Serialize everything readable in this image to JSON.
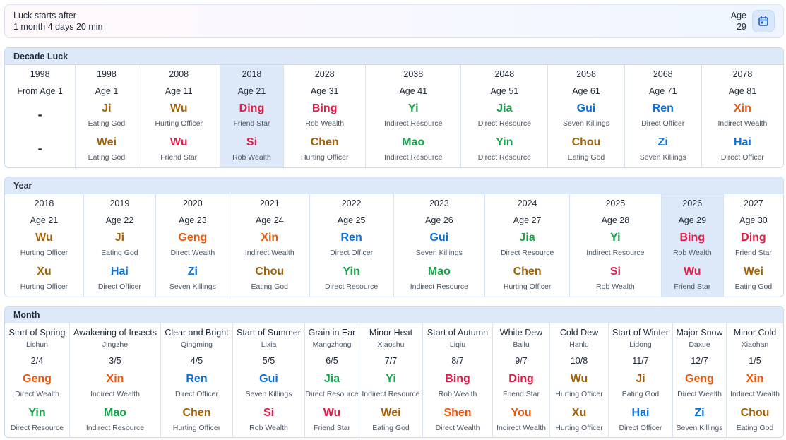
{
  "header": {
    "luck_label": "Luck starts after",
    "luck_value": "1 month 4 days 20 min",
    "age_label": "Age",
    "age_value": "29",
    "calendar_icon": "calendar-icon"
  },
  "colors": {
    "wood": "#16a34a",
    "fire": "#e11d48",
    "earth": "#a16207",
    "metal": "#ea580c",
    "water": "#0b6fd6",
    "highlight": "#dde9f8"
  },
  "decade": {
    "title": "Decade Luck",
    "columns": [
      {
        "year": "1998",
        "age": "From Age 1",
        "stem": "-",
        "stem_god": "",
        "branch": "-",
        "branch_god": "",
        "el_s": "none",
        "el_b": "none"
      },
      {
        "year": "1998",
        "age": "Age 1",
        "stem": "Ji",
        "stem_god": "Eating God",
        "branch": "Wei",
        "branch_god": "Eating God",
        "el_s": "earth",
        "el_b": "earth"
      },
      {
        "year": "2008",
        "age": "Age 11",
        "stem": "Wu",
        "stem_god": "Hurting Officer",
        "branch": "Wu",
        "branch_god": "Friend Star",
        "el_s": "earth",
        "el_b": "fire"
      },
      {
        "year": "2018",
        "age": "Age 21",
        "stem": "Ding",
        "stem_god": "Friend Star",
        "branch": "Si",
        "branch_god": "Rob Wealth",
        "el_s": "fire",
        "el_b": "fire",
        "highlight": true
      },
      {
        "year": "2028",
        "age": "Age 31",
        "stem": "Bing",
        "stem_god": "Rob Wealth",
        "branch": "Chen",
        "branch_god": "Hurting Officer",
        "el_s": "fire",
        "el_b": "earth"
      },
      {
        "year": "2038",
        "age": "Age 41",
        "stem": "Yi",
        "stem_god": "Indirect Resource",
        "branch": "Mao",
        "branch_god": "Indirect Resource",
        "el_s": "wood",
        "el_b": "wood"
      },
      {
        "year": "2048",
        "age": "Age 51",
        "stem": "Jia",
        "stem_god": "Direct Resource",
        "branch": "Yin",
        "branch_god": "Direct Resource",
        "el_s": "wood",
        "el_b": "wood"
      },
      {
        "year": "2058",
        "age": "Age 61",
        "stem": "Gui",
        "stem_god": "Seven Killings",
        "branch": "Chou",
        "branch_god": "Eating God",
        "el_s": "water",
        "el_b": "earth"
      },
      {
        "year": "2068",
        "age": "Age 71",
        "stem": "Ren",
        "stem_god": "Direct Officer",
        "branch": "Zi",
        "branch_god": "Seven Killings",
        "el_s": "water",
        "el_b": "water"
      },
      {
        "year": "2078",
        "age": "Age 81",
        "stem": "Xin",
        "stem_god": "Indirect Wealth",
        "branch": "Hai",
        "branch_god": "Direct Officer",
        "el_s": "metal",
        "el_b": "water"
      }
    ]
  },
  "year": {
    "title": "Year",
    "columns": [
      {
        "year": "2018",
        "age": "Age 21",
        "stem": "Wu",
        "stem_god": "Hurting Officer",
        "branch": "Xu",
        "branch_god": "Hurting Officer",
        "el_s": "earth",
        "el_b": "earth"
      },
      {
        "year": "2019",
        "age": "Age 22",
        "stem": "Ji",
        "stem_god": "Eating God",
        "branch": "Hai",
        "branch_god": "Direct Officer",
        "el_s": "earth",
        "el_b": "water"
      },
      {
        "year": "2020",
        "age": "Age 23",
        "stem": "Geng",
        "stem_god": "Direct Wealth",
        "branch": "Zi",
        "branch_god": "Seven Killings",
        "el_s": "metal",
        "el_b": "water"
      },
      {
        "year": "2021",
        "age": "Age 24",
        "stem": "Xin",
        "stem_god": "Indirect Wealth",
        "branch": "Chou",
        "branch_god": "Eating God",
        "el_s": "metal",
        "el_b": "earth"
      },
      {
        "year": "2022",
        "age": "Age 25",
        "stem": "Ren",
        "stem_god": "Direct Officer",
        "branch": "Yin",
        "branch_god": "Direct Resource",
        "el_s": "water",
        "el_b": "wood"
      },
      {
        "year": "2023",
        "age": "Age 26",
        "stem": "Gui",
        "stem_god": "Seven Killings",
        "branch": "Mao",
        "branch_god": "Indirect Resource",
        "el_s": "water",
        "el_b": "wood"
      },
      {
        "year": "2024",
        "age": "Age 27",
        "stem": "Jia",
        "stem_god": "Direct Resource",
        "branch": "Chen",
        "branch_god": "Hurting Officer",
        "el_s": "wood",
        "el_b": "earth"
      },
      {
        "year": "2025",
        "age": "Age 28",
        "stem": "Yi",
        "stem_god": "Indirect Resource",
        "branch": "Si",
        "branch_god": "Rob Wealth",
        "el_s": "wood",
        "el_b": "fire"
      },
      {
        "year": "2026",
        "age": "Age 29",
        "stem": "Bing",
        "stem_god": "Rob Wealth",
        "branch": "Wu",
        "branch_god": "Friend Star",
        "el_s": "fire",
        "el_b": "fire",
        "highlight": true
      },
      {
        "year": "2027",
        "age": "Age 30",
        "stem": "Ding",
        "stem_god": "Friend Star",
        "branch": "Wei",
        "branch_god": "Eating God",
        "el_s": "fire",
        "el_b": "earth"
      }
    ]
  },
  "month": {
    "title": "Month",
    "columns": [
      {
        "name": "Start of Spring",
        "pinyin": "Lichun",
        "date": "2/4",
        "stem": "Geng",
        "stem_god": "Direct Wealth",
        "branch": "Yin",
        "branch_god": "Direct Resource",
        "el_s": "metal",
        "el_b": "wood"
      },
      {
        "name": "Awakening of Insects",
        "pinyin": "Jingzhe",
        "date": "3/5",
        "stem": "Xin",
        "stem_god": "Indirect Wealth",
        "branch": "Mao",
        "branch_god": "Indirect Resource",
        "el_s": "metal",
        "el_b": "wood"
      },
      {
        "name": "Clear and Bright",
        "pinyin": "Qingming",
        "date": "4/5",
        "stem": "Ren",
        "stem_god": "Direct Officer",
        "branch": "Chen",
        "branch_god": "Hurting Officer",
        "el_s": "water",
        "el_b": "earth"
      },
      {
        "name": "Start of Summer",
        "pinyin": "Lixia",
        "date": "5/5",
        "stem": "Gui",
        "stem_god": "Seven Killings",
        "branch": "Si",
        "branch_god": "Rob Wealth",
        "el_s": "water",
        "el_b": "fire"
      },
      {
        "name": "Grain in Ear",
        "pinyin": "Mangzhong",
        "date": "6/5",
        "stem": "Jia",
        "stem_god": "Direct Resource",
        "branch": "Wu",
        "branch_god": "Friend Star",
        "el_s": "wood",
        "el_b": "fire"
      },
      {
        "name": "Minor Heat",
        "pinyin": "Xiaoshu",
        "date": "7/7",
        "stem": "Yi",
        "stem_god": "Indirect Resource",
        "branch": "Wei",
        "branch_god": "Eating God",
        "el_s": "wood",
        "el_b": "earth"
      },
      {
        "name": "Start of Autumn",
        "pinyin": "Liqiu",
        "date": "8/7",
        "stem": "Bing",
        "stem_god": "Rob Wealth",
        "branch": "Shen",
        "branch_god": "Direct Wealth",
        "el_s": "fire",
        "el_b": "metal"
      },
      {
        "name": "White Dew",
        "pinyin": "Bailu",
        "date": "9/7",
        "stem": "Ding",
        "stem_god": "Friend Star",
        "branch": "You",
        "branch_god": "Indirect Wealth",
        "el_s": "fire",
        "el_b": "metal"
      },
      {
        "name": "Cold Dew",
        "pinyin": "Hanlu",
        "date": "10/8",
        "stem": "Wu",
        "stem_god": "Hurting Officer",
        "branch": "Xu",
        "branch_god": "Hurting Officer",
        "el_s": "earth",
        "el_b": "earth"
      },
      {
        "name": "Start of Winter",
        "pinyin": "Lidong",
        "date": "11/7",
        "stem": "Ji",
        "stem_god": "Eating God",
        "branch": "Hai",
        "branch_god": "Direct Officer",
        "el_s": "earth",
        "el_b": "water"
      },
      {
        "name": "Major Snow",
        "pinyin": "Daxue",
        "date": "12/7",
        "stem": "Geng",
        "stem_god": "Direct Wealth",
        "branch": "Zi",
        "branch_god": "Seven Killings",
        "el_s": "metal",
        "el_b": "water"
      },
      {
        "name": "Minor Cold",
        "pinyin": "Xiaohan",
        "date": "1/5",
        "stem": "Xin",
        "stem_god": "Indirect Wealth",
        "branch": "Chou",
        "branch_god": "Eating God",
        "el_s": "metal",
        "el_b": "earth"
      }
    ]
  }
}
